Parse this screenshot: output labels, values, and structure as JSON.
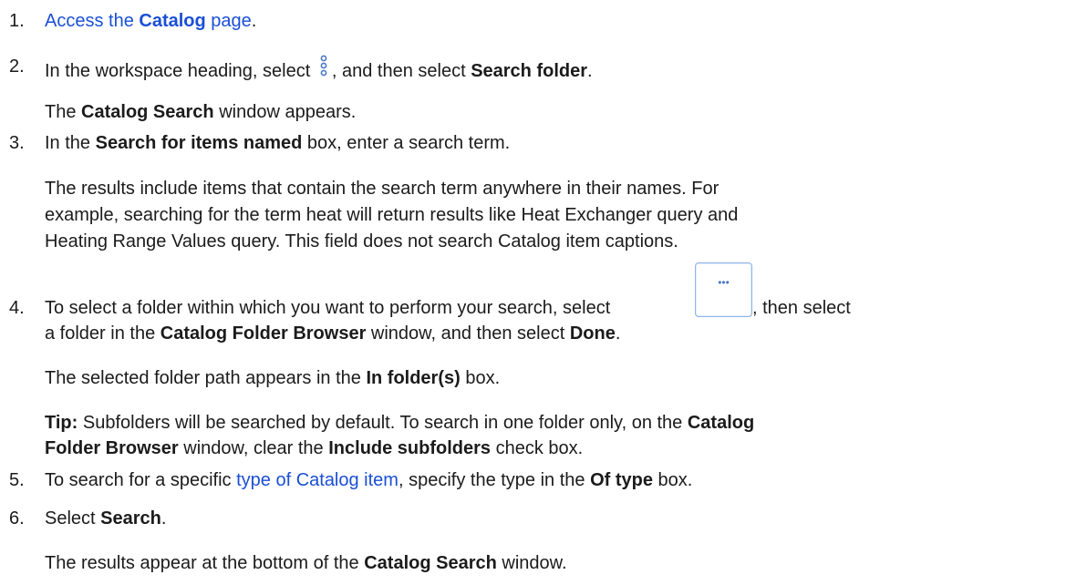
{
  "steps": [
    {
      "num": "1.",
      "link_pre": "Access the ",
      "link_bold": "Catalog",
      "link_post": " page",
      "after": "."
    },
    {
      "num": "2.",
      "pre": "In the workspace heading, select ",
      "icon": "more-vertical-icon",
      "mid": ", and then select ",
      "bold": "Search folder",
      "after": "."
    },
    {
      "num": "3.",
      "pre": "In the ",
      "bold": "Search for items named",
      "post": " box, enter a search term."
    },
    {
      "num": "4.",
      "pre": "To select a folder within which you want to perform your search, select ",
      "button_icon": "ellipsis-icon",
      "post": ", then select"
    },
    {
      "num": "5.",
      "pre": "To search for a specific ",
      "link": "type of Catalog item",
      "mid": ", specify the type in the ",
      "bold": "Of type",
      "post": " box."
    },
    {
      "num": "6.",
      "pre": "Select ",
      "bold": "Search",
      "after": "."
    }
  ],
  "step2_result": {
    "pre": "The ",
    "bold": "Catalog Search",
    "post": " window appears."
  },
  "step3_para": [
    "The results include items that contain the search term anywhere in their names. For",
    "example, searching for the term heat will return results like Heat Exchanger query and",
    "Heating Range Values query. This field does not search Catalog item captions."
  ],
  "step4_cont": {
    "pre": "a folder in the ",
    "bold1": "Catalog Folder Browser",
    "mid": " window, and then select ",
    "bold2": "Done",
    "after": "."
  },
  "step4_result": {
    "pre": "The selected folder path appears in the ",
    "bold": "In folder(s)",
    "post": " box."
  },
  "tip": {
    "label": "Tip:",
    "line1_pre": " Subfolders will be searched by default. To search in one folder only, on the ",
    "line1_bold": "Catalog",
    "line2_bold": "Folder Browser",
    "line2_mid": " window, clear the ",
    "line2_bold2": "Include subfolders",
    "line2_post": " check box."
  },
  "step6_result": {
    "pre": "The results appear at the bottom of the ",
    "bold": "Catalog Search",
    "post": " window."
  },
  "colors": {
    "link": "#1a4fd6",
    "text": "#1b1b1b",
    "icon": "#4a78c8"
  }
}
